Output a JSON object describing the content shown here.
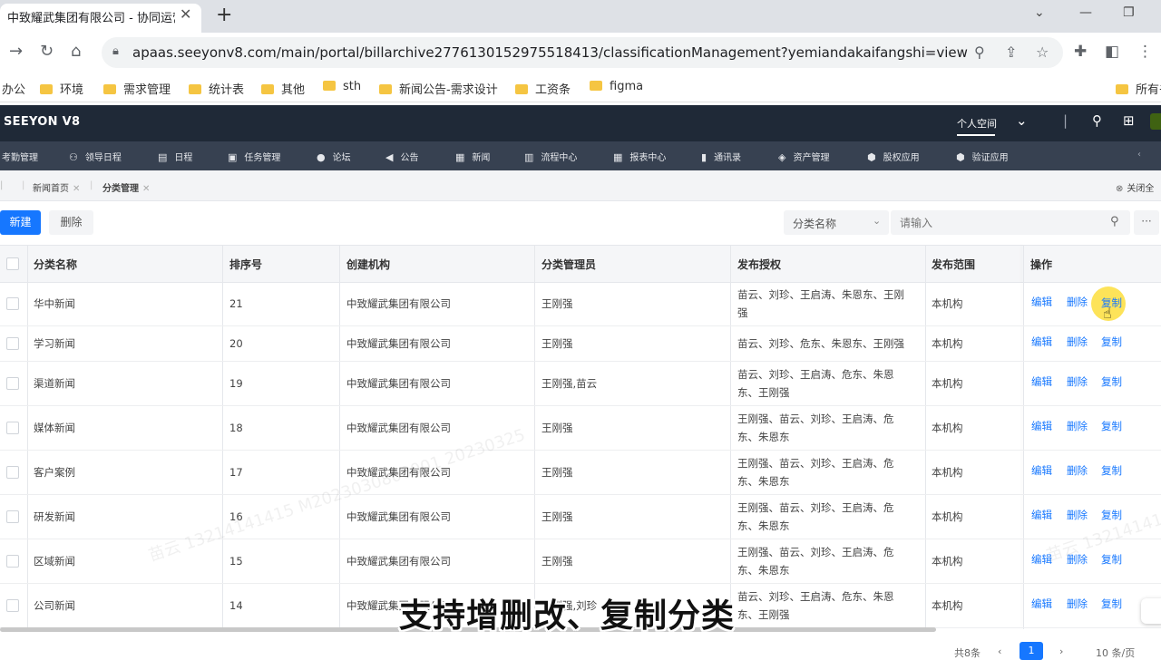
{
  "browser": {
    "tab_title": "中致耀武集团有限公司 - 协同运营",
    "tab_close": "✕",
    "new_tab": "+",
    "url": "apaas.seeyonv8.com/main/portal/billarchive2776130152975518413/classificationManagement?yemiandakaifangshi=view",
    "bookmarks": [
      "办公",
      "环境",
      "需求管理",
      "统计表",
      "其他",
      "sth",
      "新闻公告-需求设计",
      "工资条",
      "figma",
      "所有书"
    ]
  },
  "app": {
    "brand": "SEEYON V8",
    "personal_space": "个人空间",
    "menu": [
      {
        "icon": "calendar-check-icon",
        "glyph": "",
        "label": "考勤管理"
      },
      {
        "icon": "leader-schedule-icon",
        "glyph": "⚇",
        "label": "领导日程"
      },
      {
        "icon": "calendar-icon",
        "glyph": "▤",
        "label": "日程"
      },
      {
        "icon": "task-icon",
        "glyph": "▣",
        "label": "任务管理"
      },
      {
        "icon": "forum-icon",
        "glyph": "●",
        "label": "论坛"
      },
      {
        "icon": "announcement-icon",
        "glyph": "◀",
        "label": "公告"
      },
      {
        "icon": "news-icon",
        "glyph": "▦",
        "label": "新闻"
      },
      {
        "icon": "process-icon",
        "glyph": "▥",
        "label": "流程中心"
      },
      {
        "icon": "report-icon",
        "glyph": "▦",
        "label": "报表中心"
      },
      {
        "icon": "contacts-icon",
        "glyph": "▮",
        "label": "通讯录"
      },
      {
        "icon": "assets-icon",
        "glyph": "◈",
        "label": "资产管理"
      },
      {
        "icon": "equity-icon",
        "glyph": "⬢",
        "label": "股权应用"
      },
      {
        "icon": "verify-icon",
        "glyph": "⬢",
        "label": "验证应用"
      }
    ],
    "page_tabs": [
      "新闻首页",
      "分类管理"
    ],
    "close_all": "关闭全"
  },
  "actions": {
    "new_label": "新建",
    "delete_label": "删除",
    "filter_field": "分类名称",
    "search_placeholder": "请输入",
    "more": "···"
  },
  "table": {
    "columns": [
      "分类名称",
      "排序号",
      "创建机构",
      "分类管理员",
      "发布授权",
      "发布范围",
      "操作"
    ],
    "ops": [
      "编辑",
      "删除",
      "复制"
    ],
    "rows": [
      {
        "name": "华中新闻",
        "order": "21",
        "org": "中致耀武集团有限公司",
        "admin": "王刚强",
        "auth_line1": "苗云、刘珍、王启涛、朱恩东、王刚",
        "auth_line2": "强",
        "scope": "本机构"
      },
      {
        "name": "学习新闻",
        "order": "20",
        "org": "中致耀武集团有限公司",
        "admin": "王刚强",
        "auth_line1": "苗云、刘珍、危东、朱恩东、王刚强",
        "auth_line2": "",
        "scope": "本机构"
      },
      {
        "name": "渠道新闻",
        "order": "19",
        "org": "中致耀武集团有限公司",
        "admin": "王刚强,苗云",
        "auth_line1": "苗云、刘珍、王启涛、危东、朱恩",
        "auth_line2": "东、王刚强",
        "scope": "本机构"
      },
      {
        "name": "媒体新闻",
        "order": "18",
        "org": "中致耀武集团有限公司",
        "admin": "王刚强",
        "auth_line1": "王刚强、苗云、刘珍、王启涛、危",
        "auth_line2": "东、朱恩东",
        "scope": "本机构"
      },
      {
        "name": "客户案例",
        "order": "17",
        "org": "中致耀武集团有限公司",
        "admin": "王刚强",
        "auth_line1": "王刚强、苗云、刘珍、王启涛、危",
        "auth_line2": "东、朱恩东",
        "scope": "本机构"
      },
      {
        "name": "研发新闻",
        "order": "16",
        "org": "中致耀武集团有限公司",
        "admin": "王刚强",
        "auth_line1": "王刚强、苗云、刘珍、王启涛、危",
        "auth_line2": "东、朱恩东",
        "scope": "本机构"
      },
      {
        "name": "区域新闻",
        "order": "15",
        "org": "中致耀武集团有限公司",
        "admin": "王刚强",
        "auth_line1": "王刚强、苗云、刘珍、王启涛、危",
        "auth_line2": "东、朱恩东",
        "scope": "本机构"
      },
      {
        "name": "公司新闻",
        "order": "14",
        "org": "中致耀武集团有限公司",
        "admin": "王刚强,刘珍",
        "auth_line1": "苗云、刘珍、王启涛、危东、朱恩",
        "auth_line2": "东、王刚强",
        "scope": "本机构"
      }
    ]
  },
  "watermark": [
    "苗云 13214141415 M2023030800001 20230325",
    "苗云 13214141415 M2023030800001 20230325"
  ],
  "pagination": {
    "total": "共8条",
    "current": "1",
    "page_size": "10 条/页"
  },
  "subtitle": "支持增删改、复制分类"
}
